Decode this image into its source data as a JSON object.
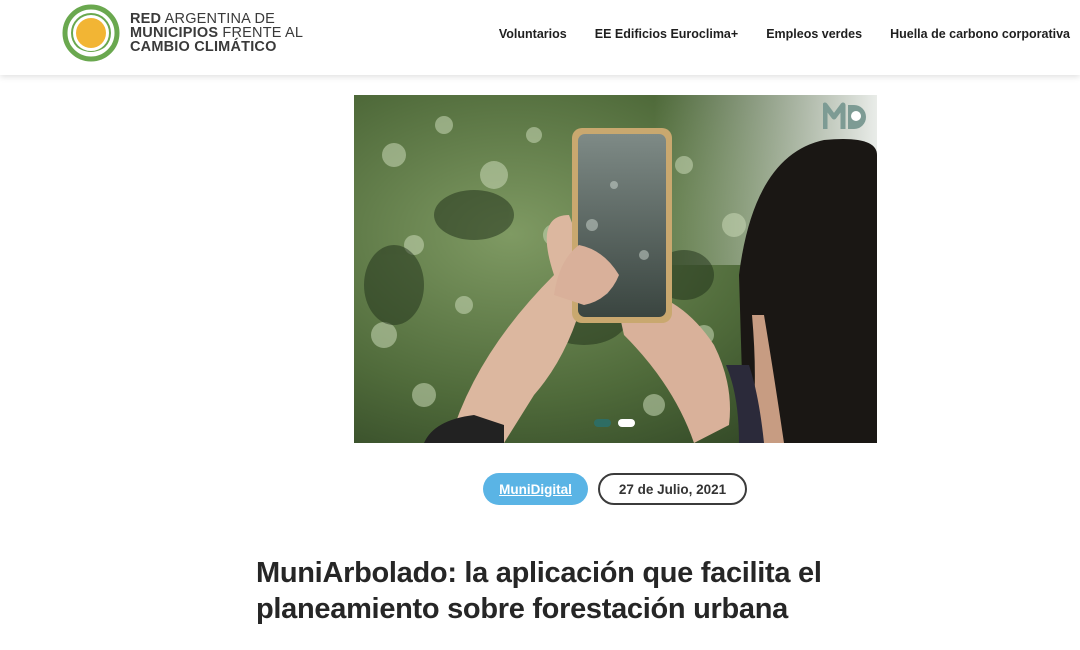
{
  "header": {
    "logo": {
      "line1_bold": "RED",
      "line1_rest": " ARGENTINA DE",
      "line2_bold": "MUNICIPIOS",
      "line2_rest": " FRENTE AL",
      "line3_bold": "CAMBIO CLIMÁTICO"
    },
    "nav": [
      {
        "label": "Voluntarios"
      },
      {
        "label": "EE Edificios Euroclima+"
      },
      {
        "label": "Empleos verdes"
      },
      {
        "label": "Huella de carbono corporativa"
      }
    ]
  },
  "hero": {
    "watermark": "MD",
    "slides_count": 2,
    "active_slide": 2
  },
  "article": {
    "category": "MuniDigital",
    "date": "27 de Julio, 2021",
    "title_line1": "MuniArbolado: la aplicación que facilita el",
    "title_line2": "planeamiento sobre forestación urbana"
  },
  "colors": {
    "category_bg": "#5ab4e5",
    "logo_green": "#6aa84f",
    "logo_yellow": "#f2b534",
    "slider_dot": "#2e6d63"
  }
}
